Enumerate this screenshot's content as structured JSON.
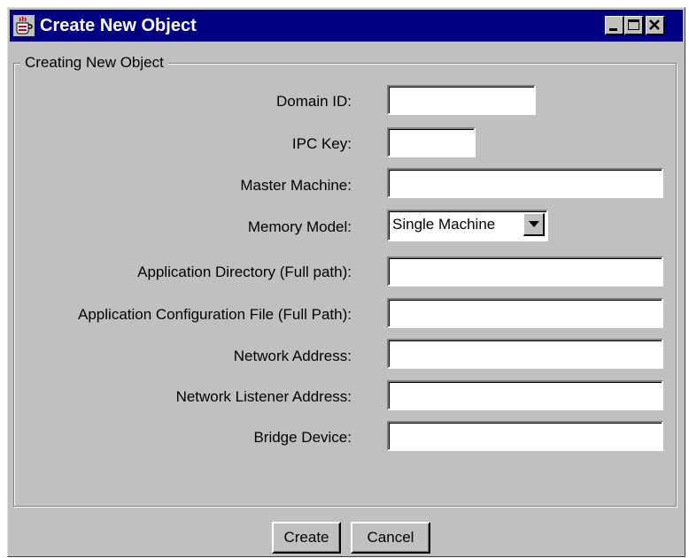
{
  "window": {
    "title": "Create New Object",
    "controls": {
      "minimize_icon": "minimize-icon",
      "maximize_icon": "maximize-icon",
      "close_icon": "close-icon"
    }
  },
  "group": {
    "title": "Creating New Object"
  },
  "form": {
    "domain_id": {
      "label": "Domain ID:",
      "value": ""
    },
    "ipc_key": {
      "label": "IPC Key:",
      "value": ""
    },
    "master_machine": {
      "label": "Master Machine:",
      "value": ""
    },
    "memory_model": {
      "label": "Memory Model:",
      "selected": "Single Machine"
    },
    "app_directory": {
      "label": "Application Directory (Full path):",
      "value": ""
    },
    "app_config_file": {
      "label": "Application Configuration File (Full Path):",
      "value": ""
    },
    "network_address": {
      "label": "Network Address:",
      "value": ""
    },
    "network_listener_address": {
      "label": "Network Listener Address:",
      "value": ""
    },
    "bridge_device": {
      "label": "Bridge Device:",
      "value": ""
    }
  },
  "buttons": {
    "create": "Create",
    "cancel": "Cancel"
  },
  "colors": {
    "titlebar": "#000080",
    "face": "#c0c0c0",
    "title_text": "#ffffff"
  }
}
